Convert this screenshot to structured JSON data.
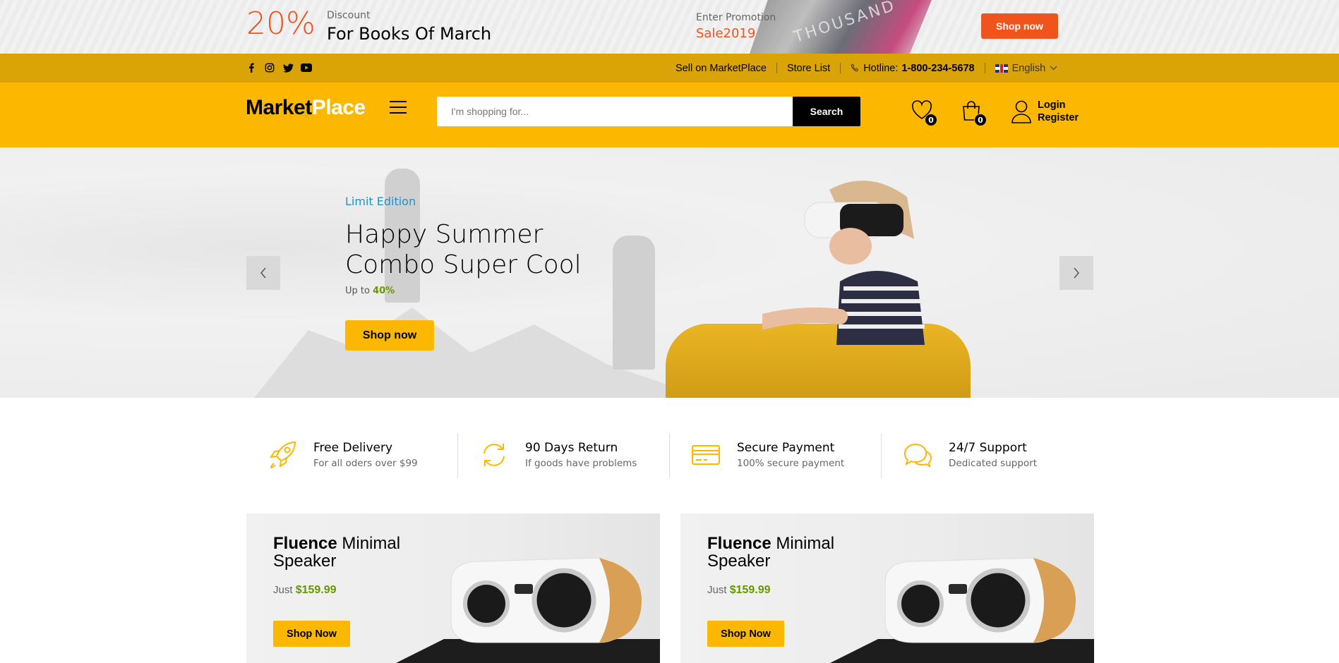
{
  "promo": {
    "percent": "20%",
    "discount_label": "Discount",
    "discount_text": "For Books Of March",
    "enter_label": "Enter Promotion",
    "code": "Sale2019",
    "shop_label": "Shop now"
  },
  "topnav": {
    "social": [
      "facebook-icon",
      "instagram-icon",
      "twitter-icon",
      "youtube-icon"
    ],
    "sell": "Sell on MarketPlace",
    "store": "Store List",
    "hotline_label": "Hotline:",
    "hotline_number": "1-800-234-5678",
    "language": "English"
  },
  "header": {
    "logo_part1": "Market",
    "logo_part2": "Place",
    "search_placeholder": "I'm shopping for...",
    "search_button": "Search",
    "wishlist_count": "0",
    "cart_count": "0",
    "login": "Login",
    "register": "Register"
  },
  "hero": {
    "tag": "Limit Edition",
    "title_line1": "Happy Summer",
    "title_line2": "Combo Super Cool",
    "upto_label": "Up to",
    "upto_value": "40%",
    "shop_label": "Shop now"
  },
  "features": [
    {
      "icon": "rocket-icon",
      "title": "Free Delivery",
      "subtitle": "For all oders over $99"
    },
    {
      "icon": "refresh-icon",
      "title": "90 Days Return",
      "subtitle": "If goods have problems"
    },
    {
      "icon": "credit-card-icon",
      "title": "Secure Payment",
      "subtitle": "100% secure payment"
    },
    {
      "icon": "chat-icon",
      "title": "24/7 Support",
      "subtitle": "Dedicated support"
    }
  ],
  "cards": [
    {
      "brand": "Fluence",
      "name1": "Minimal",
      "name2": "Speaker",
      "price_label": "Just",
      "price": "$159.99",
      "button": "Shop Now"
    },
    {
      "brand": "Fluence",
      "name1": "Minimal",
      "name2": "Speaker",
      "price_label": "Just",
      "price": "$159.99",
      "button": "Shop Now"
    }
  ],
  "colors": {
    "accent": "#fcb800",
    "topnav": "#daa407",
    "promo_orange": "#f0531c",
    "price_green": "#669900",
    "hero_tag": "#2592c4"
  }
}
